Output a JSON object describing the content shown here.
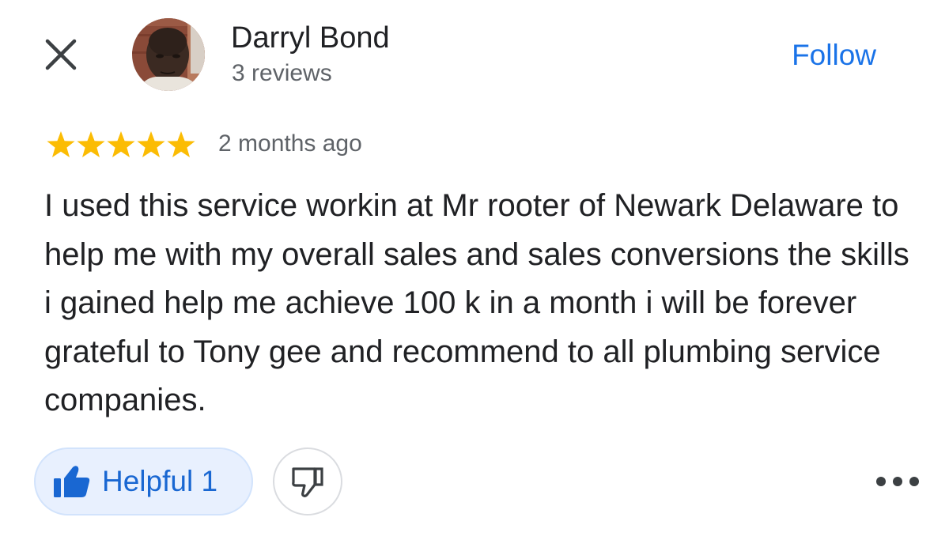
{
  "header": {
    "close_icon": "close-icon",
    "author_name": "Darryl Bond",
    "author_meta": "3 reviews",
    "follow_label": "Follow"
  },
  "review": {
    "rating": 5,
    "rating_max": 5,
    "star_color": "#fbbc04",
    "date": "2 months ago",
    "text": "I used this service workin at Mr rooter of Newark Delaware to help me with my overall sales and sales conversions the skills i gained help me achieve 100 k in a month i will be forever grateful to Tony gee and recommend to all plumbing service companies."
  },
  "actions": {
    "helpful_label": "Helpful 1",
    "helpful_icon": "thumbs-up-icon",
    "dislike_icon": "thumbs-down-icon",
    "more_icon": "more-horizontal-icon"
  },
  "colors": {
    "accent": "#1a73e8",
    "helpful_bg": "#e8f0fe",
    "helpful_text": "#1967d2",
    "secondary_text": "#5f6368",
    "primary_text": "#202124"
  }
}
